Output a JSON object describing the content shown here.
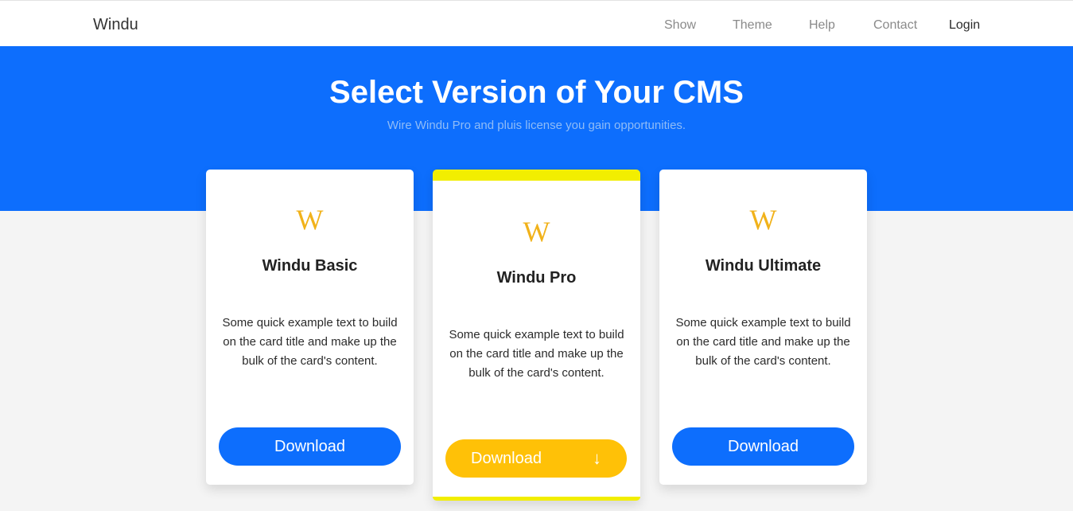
{
  "navbar": {
    "brand": "Windu",
    "links": [
      "Show",
      "Theme",
      "Help",
      "Contact"
    ],
    "login": "Login"
  },
  "hero": {
    "title": "Select Version of Your CMS",
    "subtitle": "Wire Windu Pro and pluis license you gain opportunities."
  },
  "cards": [
    {
      "logo": "W",
      "title": "Windu Basic",
      "text": "Some quick example text to build on the card title and make up the bulk of the card's content.",
      "button": "Download"
    },
    {
      "logo": "W",
      "title": "Windu Pro",
      "text": "Some quick example text to build on the card title and make up the bulk of the card's content.",
      "button": "Download",
      "button_icon": "↓"
    },
    {
      "logo": "W",
      "title": "Windu Ultimate",
      "text": "Some quick example text to build on the card title and make up the bulk of the card's content.",
      "button": "Download"
    }
  ],
  "colors": {
    "primary": "#0d6efd",
    "accent": "#ffc107",
    "featured_border": "#f2ee00",
    "logo": "#f1b21a"
  },
  "icons": {
    "logo": "windu-w-logo-icon",
    "download_arrow": "arrow-down-icon"
  }
}
